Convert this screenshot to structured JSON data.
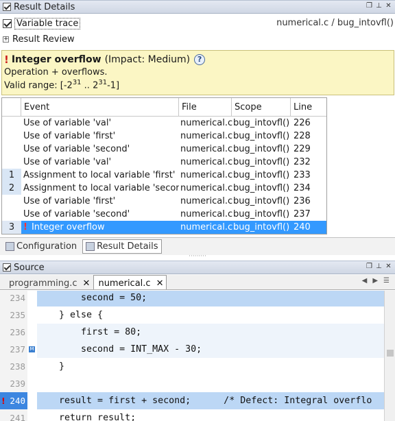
{
  "result_panel": {
    "title": "Result Details"
  },
  "toolbar": {
    "trace_label": "Variable trace",
    "trace_checked": true,
    "path": "numerical.c / bug_intovfl()"
  },
  "review": {
    "label": "Result Review",
    "expander": "+"
  },
  "defect": {
    "name": "Integer overflow",
    "impact": "(Impact: Medium)",
    "description": "Operation + overflows.",
    "range_prefix": "Valid range: [-2",
    "range_exp1": "31",
    "range_mid": " .. 2",
    "range_exp2": "31",
    "range_suffix": "-1]"
  },
  "events": {
    "headers": [
      "Event",
      "File",
      "Scope",
      "Line"
    ],
    "rows": [
      {
        "num": "",
        "event": "Use of variable 'val'",
        "file": "numerical.c",
        "scope": "bug_intovfl()",
        "line": "226"
      },
      {
        "num": "",
        "event": "Use of variable 'first'",
        "file": "numerical.c",
        "scope": "bug_intovfl()",
        "line": "228"
      },
      {
        "num": "",
        "event": "Use of variable 'second'",
        "file": "numerical.c",
        "scope": "bug_intovfl()",
        "line": "229"
      },
      {
        "num": "",
        "event": "Use of variable 'val'",
        "file": "numerical.c",
        "scope": "bug_intovfl()",
        "line": "232"
      },
      {
        "num": "1",
        "event": "Assignment to local variable 'first'",
        "file": "numerical.c",
        "scope": "bug_intovfl()",
        "line": "233"
      },
      {
        "num": "2",
        "event": "Assignment to local variable 'second'",
        "file": "numerical.c",
        "scope": "bug_intovfl()",
        "line": "234"
      },
      {
        "num": "",
        "event": "Use of variable 'first'",
        "file": "numerical.c",
        "scope": "bug_intovfl()",
        "line": "236"
      },
      {
        "num": "",
        "event": "Use of variable 'second'",
        "file": "numerical.c",
        "scope": "bug_intovfl()",
        "line": "237"
      },
      {
        "num": "3",
        "event": "Integer overflow",
        "file": "numerical.c",
        "scope": "bug_intovfl()",
        "line": "240",
        "selected": true
      }
    ]
  },
  "bottom_tabs": [
    {
      "label": "Configuration",
      "active": false
    },
    {
      "label": "Result Details",
      "active": true
    }
  ],
  "source_panel": {
    "title": "Source"
  },
  "source_tabs": [
    {
      "label": "programming.c",
      "active": false,
      "close": "✕"
    },
    {
      "label": "numerical.c",
      "active": true,
      "close": "✕"
    }
  ],
  "code_lines": [
    {
      "num": "234",
      "text": "        second = 50;"
    },
    {
      "num": "235",
      "text": "    } else {"
    },
    {
      "num": "236",
      "text": "        first = 80;"
    },
    {
      "num": "237",
      "text": "        second = INT_MAX - 30;"
    },
    {
      "num": "238",
      "text": "    }"
    },
    {
      "num": "239",
      "text": ""
    },
    {
      "num": "240",
      "text": "    result = first + second;      /* Defect: Integral overflo"
    },
    {
      "num": "241",
      "text": "    return result;"
    }
  ],
  "colors": {
    "selection": "#3399ff",
    "highlight": "#bcd7f5",
    "defect_bg": "#fbf6c4",
    "error": "#cc1f1f"
  }
}
